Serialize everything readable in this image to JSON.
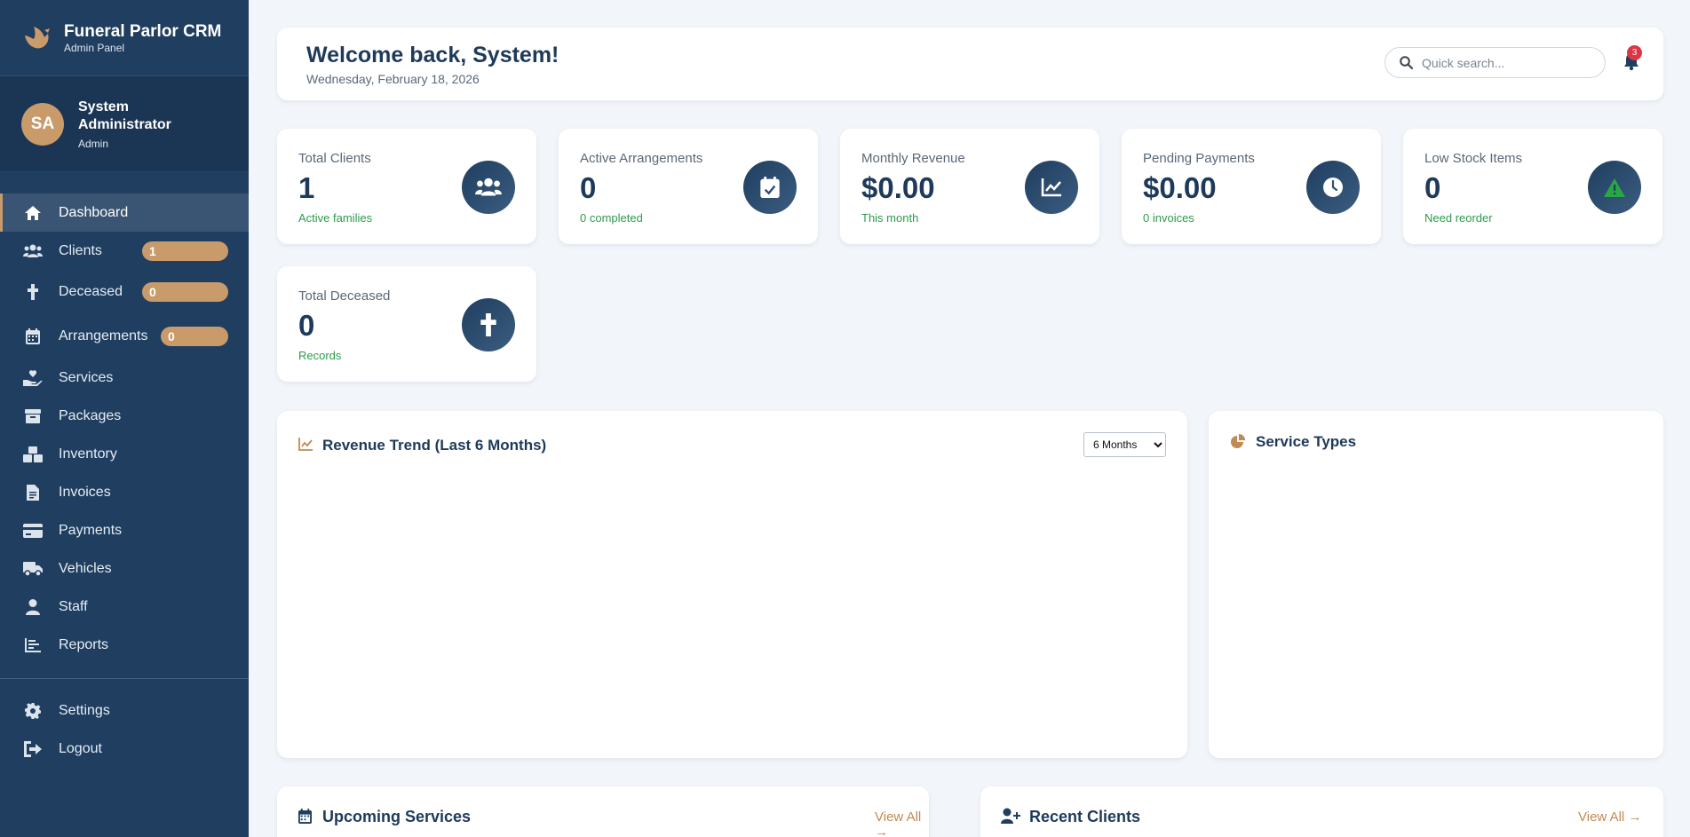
{
  "brand": {
    "title": "Funeral Parlor CRM",
    "subtitle": "Admin Panel"
  },
  "user": {
    "initials": "SA",
    "name": "System Administrator",
    "role": "Admin"
  },
  "nav": {
    "dashboard": "Dashboard",
    "clients": "Clients",
    "clients_badge": "1",
    "deceased": "Deceased",
    "deceased_badge": "0",
    "arrangements": "Arrangements",
    "arrangements_badge": "0",
    "services": "Services",
    "packages": "Packages",
    "inventory": "Inventory",
    "invoices": "Invoices",
    "payments": "Payments",
    "vehicles": "Vehicles",
    "staff": "Staff",
    "reports": "Reports",
    "settings": "Settings",
    "logout": "Logout"
  },
  "header": {
    "welcome": "Welcome back, System!",
    "date": "Wednesday, February 18, 2026",
    "search_placeholder": "Quick search...",
    "notification_count": "3"
  },
  "stats": [
    {
      "label": "Total Clients",
      "value": "1",
      "sub": "Active families",
      "icon": "users-icon"
    },
    {
      "label": "Active Arrangements",
      "value": "0",
      "sub": "0 completed",
      "icon": "calendar-check-icon"
    },
    {
      "label": "Monthly Revenue",
      "value": "$0.00",
      "sub": "This month",
      "icon": "chart-line-icon"
    },
    {
      "label": "Pending Payments",
      "value": "$0.00",
      "sub": "0 invoices",
      "icon": "clock-icon"
    },
    {
      "label": "Low Stock Items",
      "value": "0",
      "sub": "Need reorder",
      "icon": "warning-icon"
    },
    {
      "label": "Total Deceased",
      "value": "0",
      "sub": "Records",
      "icon": "cross-icon"
    }
  ],
  "revenue": {
    "title": "Revenue Trend (Last 6 Months)",
    "select_value": "6 Months",
    "options": [
      "6 Months"
    ]
  },
  "service_types": {
    "title": "Service Types"
  },
  "upcoming": {
    "title": "Upcoming Services",
    "view_all": "View All"
  },
  "recent_clients": {
    "title": "Recent Clients",
    "view_all": "View All"
  },
  "colors": {
    "sidebar": "#1f3e60",
    "accent": "#c99a6a",
    "success": "#2c9c4c",
    "danger": "#dc3545"
  }
}
